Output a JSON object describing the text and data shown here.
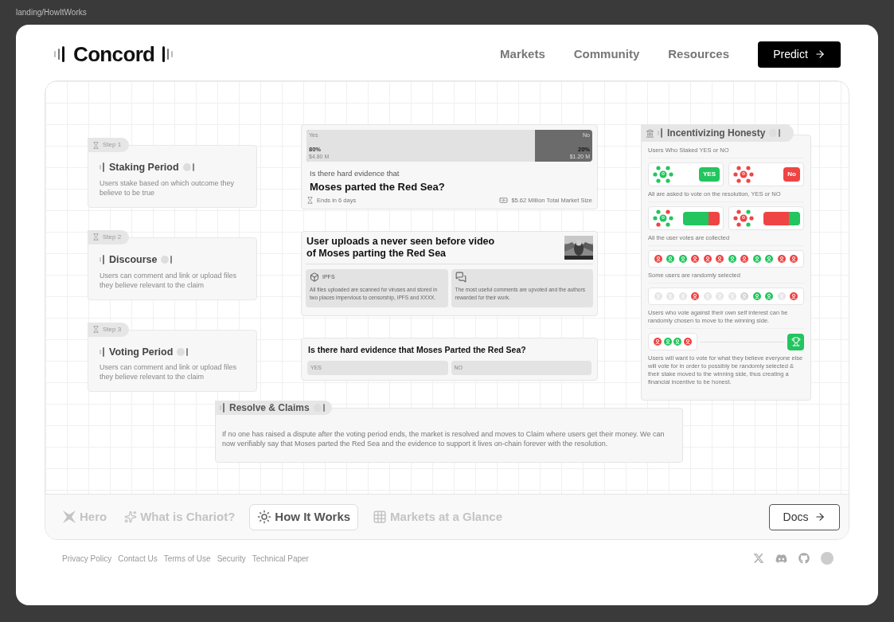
{
  "page_label": "landing/HowItWorks",
  "nav": {
    "logo": "Concord",
    "links": [
      "Markets",
      "Community",
      "Resources"
    ],
    "cta": "Predict"
  },
  "steps": [
    {
      "tag": "Step 1",
      "title": "Staking Period",
      "text": "Users stake based on which outcome they believe to be true"
    },
    {
      "tag": "Step 2",
      "title": "Discourse",
      "text": "Users can comment and link or upload files they believe relevant to the claim"
    },
    {
      "tag": "Step 3",
      "title": "Voting Period",
      "text": "Users can comment and link or upload files they believe relevant to the claim"
    }
  ],
  "market": {
    "yes_label": "Yes",
    "no_label": "No",
    "yes_pct": "80%",
    "no_pct": "20%",
    "yes_amount": "$4.80 M",
    "no_amount": "$1.20 M",
    "level": 0.8,
    "question_prefix": "Is there hard evidence that",
    "question": "Moses parted the Red Sea?",
    "ends": "Ends in 6 days",
    "size": "$5.62 Million Total Market Size"
  },
  "upload": {
    "title": "User uploads a never seen before video of Moses parting the Red Sea",
    "cards": [
      {
        "kind": "ipfs",
        "label": "IPFS",
        "text": "All files uploaded are scanned for viruses and stored in two places impervious to censorship, IPFS and XXXX."
      },
      {
        "kind": "comments",
        "text": "The most useful comments are upvoted and the authors rewarded for their work."
      }
    ]
  },
  "vote": {
    "question": "Is there hard evidence that Moses Parted the Red Sea?",
    "options": [
      "YES",
      "NO"
    ]
  },
  "honesty": {
    "title": "Incentivizing Honesty",
    "stake_caption": "Users Who Staked YES or NO",
    "stake": [
      {
        "dots": [
          {
            "color": "#22c55e"
          },
          {
            "color": "#22c55e"
          },
          {
            "color": "#22c55e"
          },
          {
            "color": "#22c55e"
          },
          {
            "color": "#22c55e"
          },
          {
            "color": "#22c55e"
          },
          {
            "color": "#22c55e"
          }
        ],
        "badge": "YES",
        "color": "#22c55e"
      },
      {
        "dots": [
          {
            "color": "#ef4444"
          },
          {
            "color": "#ef4444"
          },
          {
            "color": "#ef4444"
          },
          {
            "color": "#ef4444"
          },
          {
            "color": "#ef4444"
          },
          {
            "color": "#ef4444"
          },
          {
            "color": "#ef4444"
          }
        ],
        "badge": "No",
        "color": "#ef4444"
      }
    ],
    "vote_caption": "All are asked to vote on the resolution, YES or NO",
    "votes": [
      {
        "dots": [
          {
            "color": "#22c55e"
          },
          {
            "color": "#22c55e"
          },
          {
            "color": "#ef4444"
          },
          {
            "color": "#22c55e"
          },
          {
            "color": "#22c55e"
          },
          {
            "color": "#ef4444"
          },
          {
            "color": "#22c55e"
          }
        ],
        "segments": [
          {
            "level": 0.7,
            "color": "#22c55e"
          },
          {
            "level": 0.3,
            "color": "#ef4444"
          }
        ]
      },
      {
        "dots": [
          {
            "color": "#ef4444"
          },
          {
            "color": "#ef4444"
          },
          {
            "color": "#22c55e"
          },
          {
            "color": "#ef4444"
          },
          {
            "color": "#ef4444"
          },
          {
            "color": "#ef4444"
          },
          {
            "color": "#22c55e"
          }
        ],
        "segments": [
          {
            "level": 0.7,
            "color": "#ef4444"
          },
          {
            "level": 0.3,
            "color": "#22c55e"
          }
        ]
      }
    ],
    "collected_caption": "All the user votes are collected",
    "collected": [
      {
        "color": "#ef4444"
      },
      {
        "color": "#22c55e"
      },
      {
        "color": "#22c55e"
      },
      {
        "color": "#ef4444"
      },
      {
        "color": "#ef4444"
      },
      {
        "color": "#ef4444"
      },
      {
        "color": "#22c55e"
      },
      {
        "color": "#ef4444"
      },
      {
        "color": "#22c55e"
      },
      {
        "color": "#22c55e"
      },
      {
        "color": "#ef4444"
      },
      {
        "color": "#ef4444"
      }
    ],
    "selected_caption": "Some  users are randomly selected",
    "selected": [
      {
        "color": "#e5e5e5"
      },
      {
        "color": "#e5e5e5"
      },
      {
        "color": "#e5e5e5"
      },
      {
        "color": "#ef4444"
      },
      {
        "color": "#e5e5e5"
      },
      {
        "color": "#e5e5e5"
      },
      {
        "color": "#e5e5e5"
      },
      {
        "color": "#d4d4d4"
      },
      {
        "color": "#22c55e"
      },
      {
        "color": "#22c55e"
      },
      {
        "color": "#e5e5e5"
      },
      {
        "color": "#ef4444"
      }
    ],
    "move_caption": "Users who vote against their own self interest can be randomly chosen to move to the winning side.",
    "moved": [
      {
        "color": "#ef4444"
      },
      {
        "color": "#22c55e"
      },
      {
        "color": "#22c55e"
      },
      {
        "color": "#ef4444"
      }
    ],
    "final_caption": "Users will want to vote for what they believe everyone else will vote for in order to possibly be randomly selected & their stake moved to the winning side, thus creating a financial incentive to be honest."
  },
  "resolve": {
    "title": "Resolve & Claims",
    "text": "If no one has raised a dispute after the voting period ends, the market is resolved and moves to Claim where users get their money. We can now verifiably say that Moses parted the Red Sea and the evidence to support it lives on-chain forever with the resolution."
  },
  "tabs": [
    {
      "kind": "hero",
      "label": "Hero",
      "selected": false
    },
    {
      "kind": "about",
      "label": "What is Chariot?",
      "selected": false
    },
    {
      "kind": "how",
      "label": "How It Works",
      "selected": true
    },
    {
      "kind": "markets",
      "label": "Markets at a Glance",
      "selected": false
    }
  ],
  "docs": "Docs",
  "footer_links": [
    "Privacy Policy",
    "Contact Us",
    "Terms of Use",
    "Security",
    "Technical Paper"
  ]
}
